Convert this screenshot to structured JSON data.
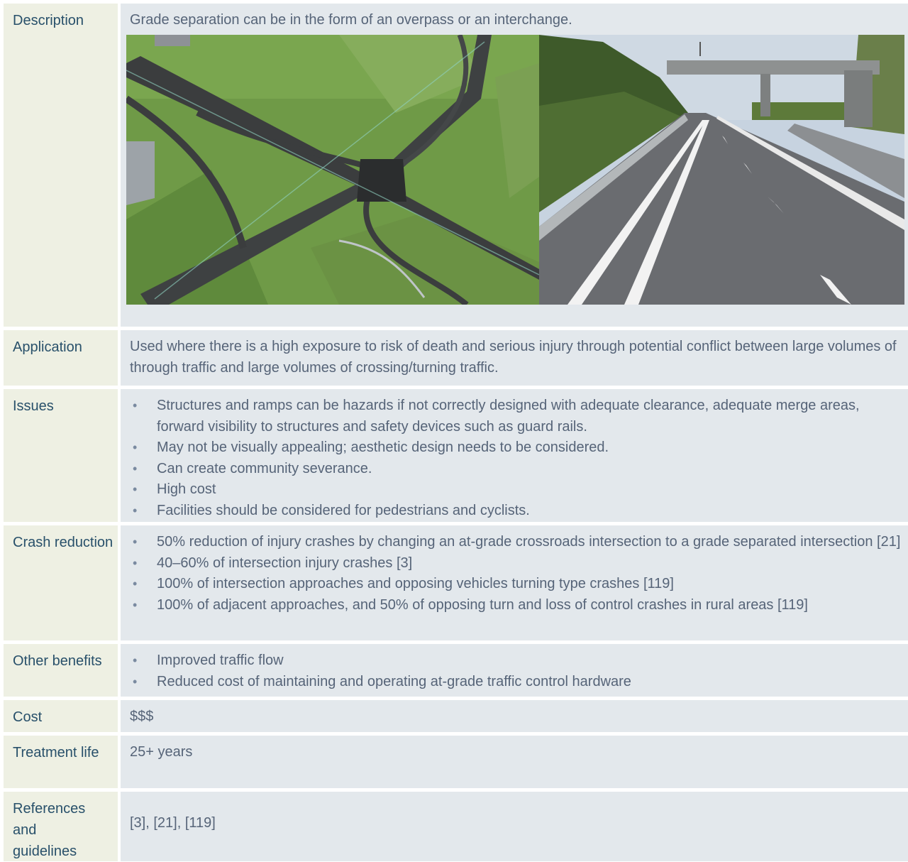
{
  "rows": {
    "description": {
      "label": "Description",
      "text": "Grade separation can be in the form of an overpass or an interchange.",
      "images": [
        {
          "alt": "Aerial rendering of a grade-separated interchange"
        },
        {
          "alt": "Motorway passing beneath an overbridge"
        }
      ]
    },
    "application": {
      "label": "Application",
      "text": "Used where there is a high exposure to risk of death and serious injury through potential conflict between large volumes of through traffic and large volumes of crossing/turning traffic."
    },
    "issues": {
      "label": "Issues",
      "items": [
        "Structures and ramps can be hazards if not correctly designed with adequate clearance, adequate merge areas, forward visibility to structures and safety devices such as guard rails.",
        "May not be visually appealing; aesthetic design needs to be considered.",
        "Can create community severance.",
        "High cost",
        "Facilities should be considered for pedestrians and cyclists."
      ]
    },
    "crash_reduction": {
      "label": "Crash reduction",
      "items": [
        "50% reduction of injury crashes by changing an at-grade crossroads intersection to a grade separated intersection [21]",
        "40–60% of intersection injury crashes [3]",
        "100% of intersection approaches and opposing vehicles turning type crashes [119]",
        "100% of adjacent approaches, and 50% of opposing turn and loss of control crashes in rural areas [119]"
      ]
    },
    "other_benefits": {
      "label": "Other benefits",
      "items": [
        "Improved traffic flow",
        "Reduced cost of maintaining and operating at-grade traffic control hardware"
      ]
    },
    "cost": {
      "label": "Cost",
      "text": "$$$"
    },
    "treatment_life": {
      "label": "Treatment life",
      "text": "25+ years"
    },
    "references": {
      "label": "References and guidelines",
      "text": "[3], [21], [119]"
    }
  },
  "bullet_char": "•",
  "colors": {
    "label_bg": "#eef0e3",
    "label_text": "#28506a",
    "content_bg": "#e3e8ec",
    "content_text": "#566478"
  }
}
